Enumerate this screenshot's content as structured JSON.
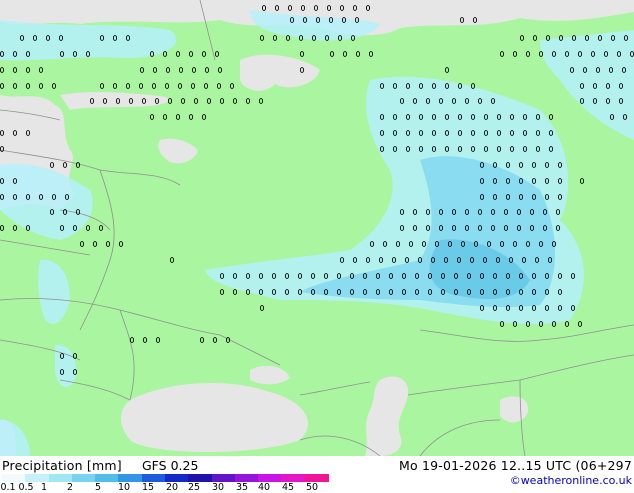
{
  "map": {
    "colors": {
      "land": "#aaf5a0",
      "sea": "#e6e6e6",
      "border": "#909090",
      "rain_light": "#b4f0fa",
      "rain_mid": "#82d8f0",
      "rain_heavy": "#64c8e6"
    }
  },
  "footer": {
    "title": "Precipitation [mm]",
    "model": "GFS 0.25",
    "datetime": "Mo 19-01-2026 12..15 UTC (06+297",
    "credit": "©weatheronline.co.uk",
    "scale": {
      "ticks": [
        "0.1",
        "0.5",
        "1",
        "2",
        "5",
        "10",
        "15",
        "20",
        "25",
        "30",
        "35",
        "40",
        "45",
        "50"
      ],
      "colors": [
        "#f0faff",
        "#c8f0fa",
        "#a0e6f5",
        "#78d2f0",
        "#50bee6",
        "#3296e6",
        "#1e5adc",
        "#1428c8",
        "#1e14aa",
        "#6414c8",
        "#9614dc",
        "#c814e6",
        "#e614c8",
        "#f01496"
      ]
    }
  }
}
